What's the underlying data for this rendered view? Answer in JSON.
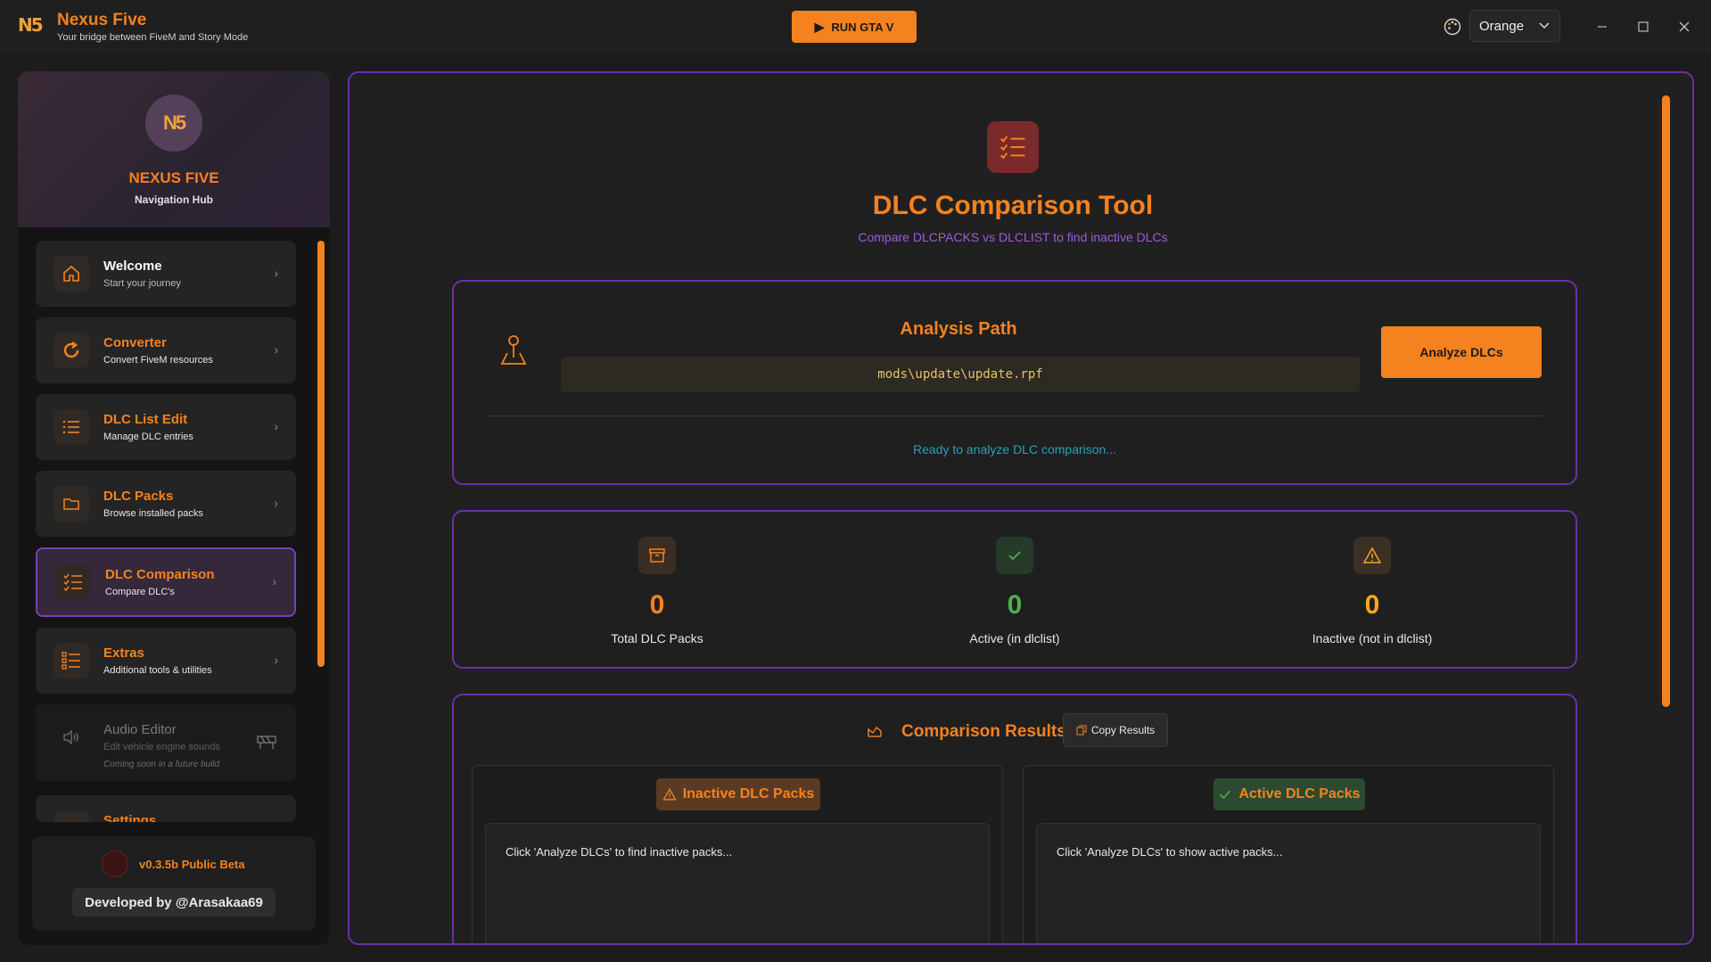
{
  "window": {
    "app_name": "Nexus Five",
    "app_subtitle": "Your bridge between FiveM and Story Mode",
    "run_button": "RUN GTA V",
    "theme_value": "Orange"
  },
  "sidebar": {
    "title": "NEXUS FIVE",
    "subtitle": "Navigation Hub",
    "items": [
      {
        "label": "Welcome",
        "desc": "Start your journey",
        "icon": "home-icon"
      },
      {
        "label": "Converter",
        "desc": "Convert FiveM resources",
        "icon": "refresh-icon"
      },
      {
        "label": "DLC List Edit",
        "desc": "Manage DLC entries",
        "icon": "list-icon"
      },
      {
        "label": "DLC Packs",
        "desc": "Browse installed packs",
        "icon": "folder-icon"
      },
      {
        "label": "DLC Comparison",
        "desc": "Compare DLC's",
        "icon": "checklist-icon"
      },
      {
        "label": "Extras",
        "desc": "Additional tools & utilities",
        "icon": "bulleted-list-icon"
      },
      {
        "label": "Audio Editor",
        "desc": "Edit vehicle engine sounds",
        "note": "Coming soon in a future build",
        "icon": "speaker-icon"
      },
      {
        "label": "Settings",
        "icon": "gear-icon"
      }
    ],
    "version": "v0.3.5b Public Beta",
    "developer": "Developed by @Arasakaa69"
  },
  "main": {
    "title": "DLC Comparison Tool",
    "subtitle": "Compare DLCPACKS vs DLCLIST to find inactive DLCs",
    "analysis": {
      "label": "Analysis Path",
      "path": "mods\\update\\update.rpf",
      "button": "Analyze DLCs",
      "status": "Ready to analyze DLC comparison..."
    },
    "stats": [
      {
        "value": "0",
        "caption": "Total DLC Packs",
        "color": "#f5821f"
      },
      {
        "value": "0",
        "caption": "Active (in dlclist)",
        "color": "#4caf50"
      },
      {
        "value": "0",
        "caption": "Inactive (not in dlclist)",
        "color": "#f5a623"
      }
    ],
    "results": {
      "title": "Comparison Results",
      "copy_button": "Copy Results",
      "inactive_label": "Inactive DLC Packs",
      "inactive_hint": "Click 'Analyze DLCs' to find inactive packs...",
      "active_label": "Active DLC Packs",
      "active_hint": "Click 'Analyze DLCs' to show active packs..."
    }
  },
  "colors": {
    "accent": "#f5821f",
    "border_purple": "#6b2fa8",
    "active_green": "#4caf50",
    "inactive_yellow": "#f5a623",
    "status_cyan": "#2aa0b8"
  }
}
